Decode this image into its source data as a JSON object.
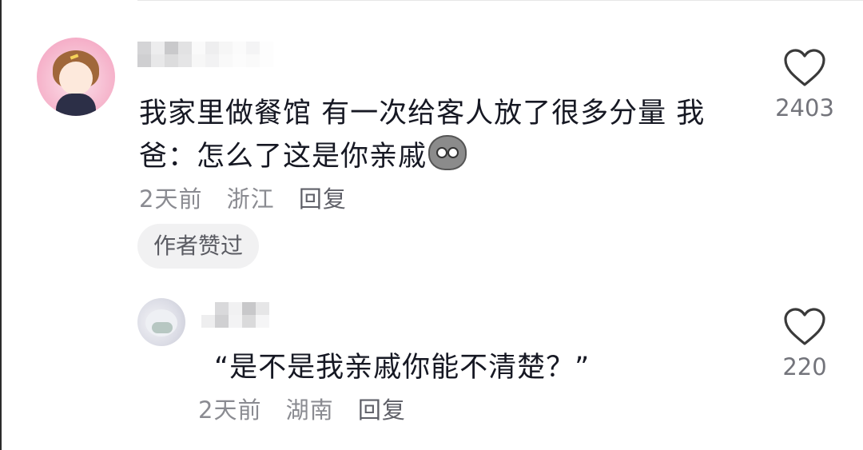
{
  "comments": [
    {
      "text": "我家里做餐馆 有一次给客人放了很多分量 我爸：怎么了这是你亲戚",
      "emoji": "shocked-face-icon",
      "time": "2天前",
      "location": "浙江",
      "reply_label": "回复",
      "badge": "作者赞过",
      "likes": "2403"
    },
    {
      "text": "“是不是我亲戚你能不清楚？”",
      "time": "2天前",
      "location": "湖南",
      "reply_label": "回复",
      "likes": "220"
    }
  ],
  "colors": {
    "text": "#161823",
    "meta": "#8a8b91",
    "badge_bg": "#f1f1f2",
    "heart": "#3a3a3a"
  }
}
